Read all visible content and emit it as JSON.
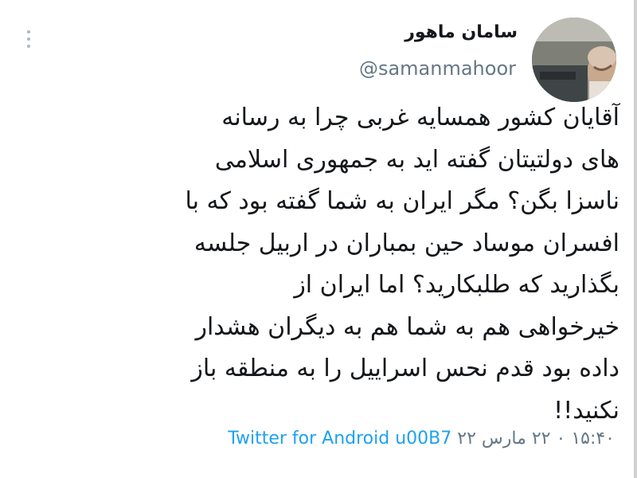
{
  "tweet": {
    "display_name": "سامان ماهور",
    "handle": "@samanmahoor",
    "text": "آقایان کشور همسایه غربی چرا به رسانه\nهای دولتیتان گفته اید به جمهوری اسلامی\nناسزا بگن؟ مگر ایران به شما گفته بود که با\nافسران موساد حین بمباران در اربیل جلسه\nبگذارید که طلبکارید؟ اما ایران از\nخیرخواهی هم به شما هم به دیگران هشدار\nداده بود قدم نحس اسراییل را به منطقه باز\nنکنید!!",
    "timestamp": "۱۵:۴۰ ۰ ۲۲ مارس ۲۲",
    "source": "Twitter for Android u00B7"
  },
  "icons": {
    "more": "more-vertical-icon",
    "avatar": "avatar-photo"
  },
  "colors": {
    "text": "#14171a",
    "secondary": "#657786",
    "link": "#1da1f2",
    "background": "#ffffff"
  }
}
